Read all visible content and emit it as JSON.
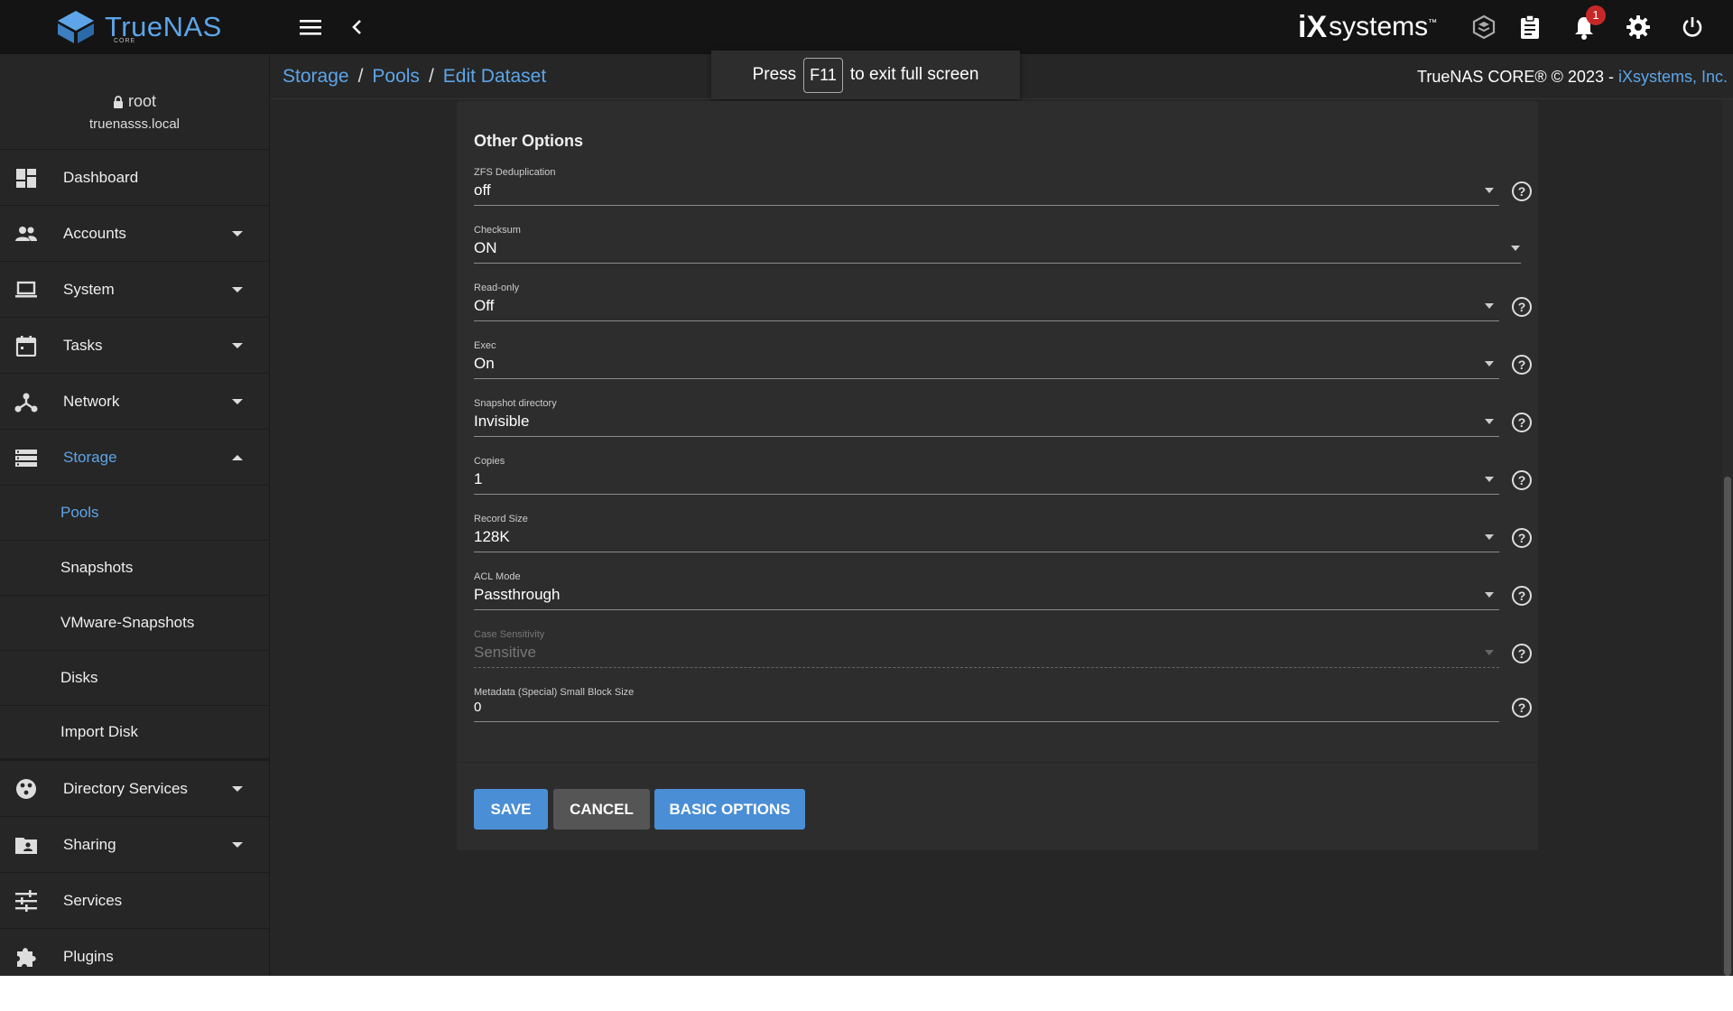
{
  "topbar": {
    "logo_text": "TrueNAS",
    "logo_sub": "CORE",
    "brand": "systems",
    "brand_mark": "iX",
    "notification_count": "1"
  },
  "user": {
    "name": "root",
    "host": "truenasss.local"
  },
  "sidebar": {
    "items": [
      {
        "label": "Dashboard"
      },
      {
        "label": "Accounts"
      },
      {
        "label": "System"
      },
      {
        "label": "Tasks"
      },
      {
        "label": "Network"
      },
      {
        "label": "Storage"
      }
    ],
    "storage_sub": [
      {
        "label": "Pools"
      },
      {
        "label": "Snapshots"
      },
      {
        "label": "VMware-Snapshots"
      },
      {
        "label": "Disks"
      },
      {
        "label": "Import Disk"
      }
    ],
    "items2": [
      {
        "label": "Directory Services"
      },
      {
        "label": "Sharing"
      },
      {
        "label": "Services"
      },
      {
        "label": "Plugins"
      }
    ]
  },
  "breadcrumb": {
    "storage": "Storage",
    "pools": "Pools",
    "current": "Edit Dataset",
    "sep": "/"
  },
  "copyright": {
    "text": "TrueNAS CORE® © 2023 - ",
    "link": "iXsystems, Inc."
  },
  "fullscreen_toast": {
    "press": "Press",
    "key": "F11",
    "rest": "to exit full screen"
  },
  "form": {
    "section_title": "Other Options",
    "fields": [
      {
        "label": "ZFS Deduplication",
        "value": "off"
      },
      {
        "label": "Checksum",
        "value": "ON"
      },
      {
        "label": "Read-only",
        "value": "Off"
      },
      {
        "label": "Exec",
        "value": "On"
      },
      {
        "label": "Snapshot directory",
        "value": "Invisible"
      },
      {
        "label": "Copies",
        "value": "1"
      },
      {
        "label": "Record Size",
        "value": "128K"
      },
      {
        "label": "ACL Mode",
        "value": "Passthrough"
      },
      {
        "label": "Case Sensitivity",
        "value": "Sensitive"
      },
      {
        "label": "Metadata (Special) Small Block Size",
        "value": "0"
      }
    ],
    "save_label": "SAVE",
    "cancel_label": "CANCEL",
    "basic_label": "BASIC OPTIONS"
  },
  "colors": {
    "accent": "#5da5e8",
    "button": "#4a8ed6",
    "background": "#262626",
    "card": "#2d2d2d"
  }
}
